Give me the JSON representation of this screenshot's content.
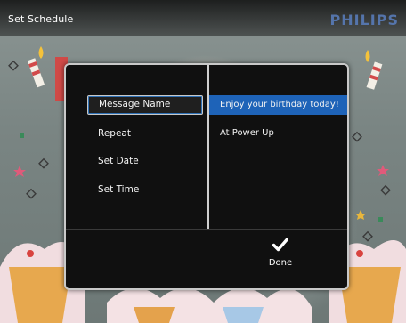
{
  "header": {
    "title": "Set Schedule",
    "brand": "PHILIPS"
  },
  "dialog": {
    "menu": [
      {
        "label": "Message Name",
        "selected": true
      },
      {
        "label": "Repeat",
        "selected": false
      },
      {
        "label": "Set Date",
        "selected": false
      },
      {
        "label": "Set Time",
        "selected": false
      }
    ],
    "values": [
      {
        "label": "Enjoy your birthday today!",
        "highlighted": true
      },
      {
        "label": "At Power Up",
        "highlighted": false
      }
    ],
    "done": {
      "icon": "check-icon",
      "label": "Done"
    }
  },
  "colors": {
    "highlight": "#1e63b8",
    "dialog_bg": "#101010",
    "border": "#c9c9c9"
  }
}
